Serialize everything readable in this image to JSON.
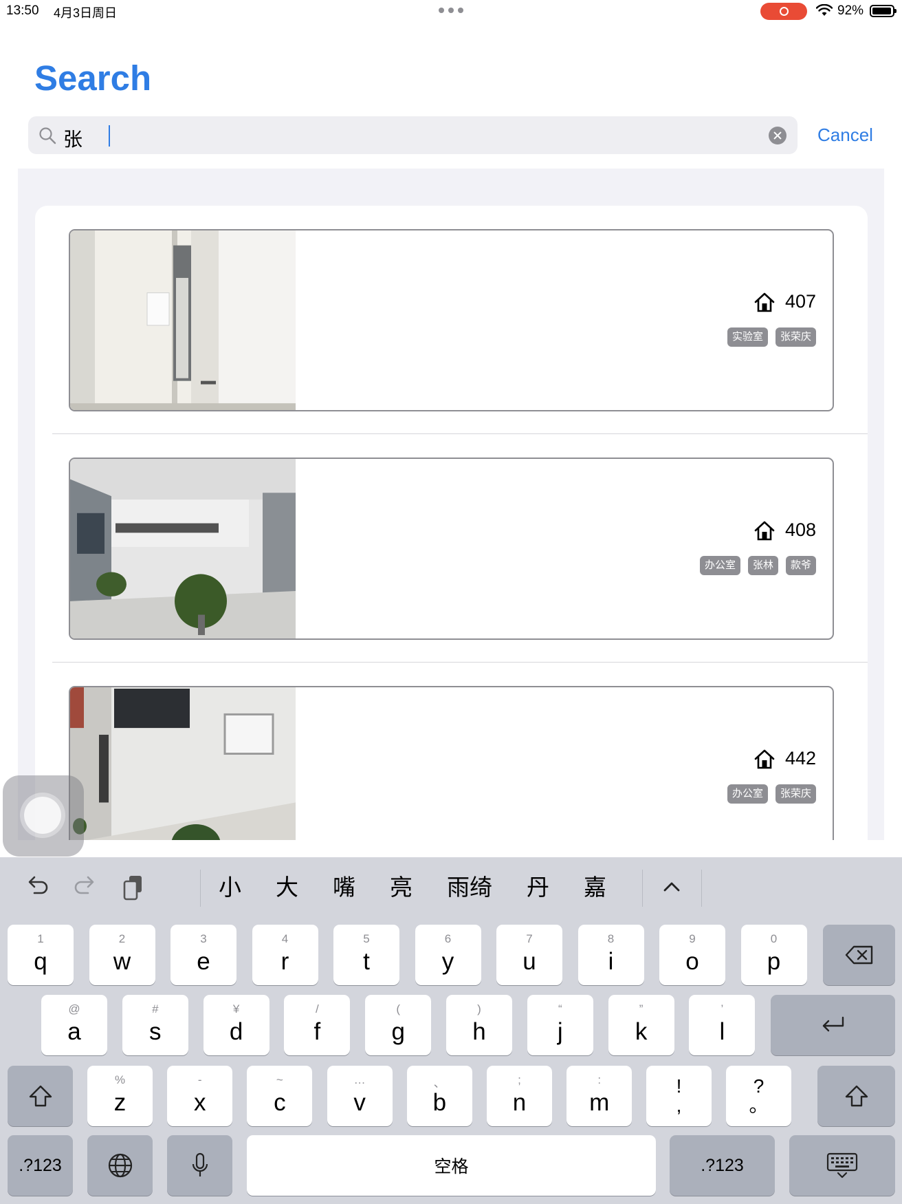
{
  "status_bar": {
    "time": "13:50",
    "date": "4月3日周日",
    "battery": "92%",
    "icons": [
      "more-dots-icon",
      "screen-record-icon",
      "wifi-icon",
      "battery-icon"
    ]
  },
  "header": {
    "title": "Search"
  },
  "search": {
    "query": "张",
    "cancel_label": "Cancel",
    "icons": [
      "search-icon",
      "clear-icon"
    ]
  },
  "results": [
    {
      "room": "407",
      "tags": [
        "实验室",
        "张荣庆"
      ],
      "icon": "house-icon"
    },
    {
      "room": "408",
      "tags": [
        "办公室",
        "张林",
        "款爷"
      ],
      "icon": "house-icon"
    },
    {
      "room": "442",
      "tags": [
        "办公室",
        "张荣庆"
      ],
      "icon": "house-icon"
    }
  ],
  "keyboard": {
    "toolbar_icons": [
      "undo-icon",
      "redo-icon",
      "clipboard-icon",
      "chevron-up-icon"
    ],
    "candidates": [
      "小",
      "大",
      "嘴",
      "亮",
      "雨绮",
      "丹",
      "嘉"
    ],
    "row1": [
      {
        "hint": "1",
        "key": "q"
      },
      {
        "hint": "2",
        "key": "w"
      },
      {
        "hint": "3",
        "key": "e"
      },
      {
        "hint": "4",
        "key": "r"
      },
      {
        "hint": "5",
        "key": "t"
      },
      {
        "hint": "6",
        "key": "y"
      },
      {
        "hint": "7",
        "key": "u"
      },
      {
        "hint": "8",
        "key": "i"
      },
      {
        "hint": "9",
        "key": "o"
      },
      {
        "hint": "0",
        "key": "p"
      }
    ],
    "row2": [
      {
        "hint": "@",
        "key": "a"
      },
      {
        "hint": "#",
        "key": "s"
      },
      {
        "hint": "¥",
        "key": "d"
      },
      {
        "hint": "/",
        "key": "f"
      },
      {
        "hint": "(",
        "key": "g"
      },
      {
        "hint": ")",
        "key": "h"
      },
      {
        "hint": "“",
        "key": "j"
      },
      {
        "hint": "”",
        "key": "k"
      },
      {
        "hint": "’",
        "key": "l"
      }
    ],
    "row3": [
      {
        "hint": "%",
        "key": "z"
      },
      {
        "hint": "-",
        "key": "x"
      },
      {
        "hint": "~",
        "key": "c"
      },
      {
        "hint": "…",
        "key": "v"
      },
      {
        "hint": "、",
        "key": "b"
      },
      {
        "hint": ";",
        "key": "n"
      },
      {
        "hint": ":",
        "key": "m"
      }
    ],
    "punct1": {
      "top": "!",
      "bottom": ","
    },
    "punct2": {
      "top": "?",
      "bottom": "。"
    },
    "numbers_label": ".?123",
    "space_label": "空格",
    "special_icons": [
      "backspace-icon",
      "return-icon",
      "shift-icon",
      "globe-icon",
      "microphone-icon",
      "keyboard-dismiss-icon"
    ]
  }
}
